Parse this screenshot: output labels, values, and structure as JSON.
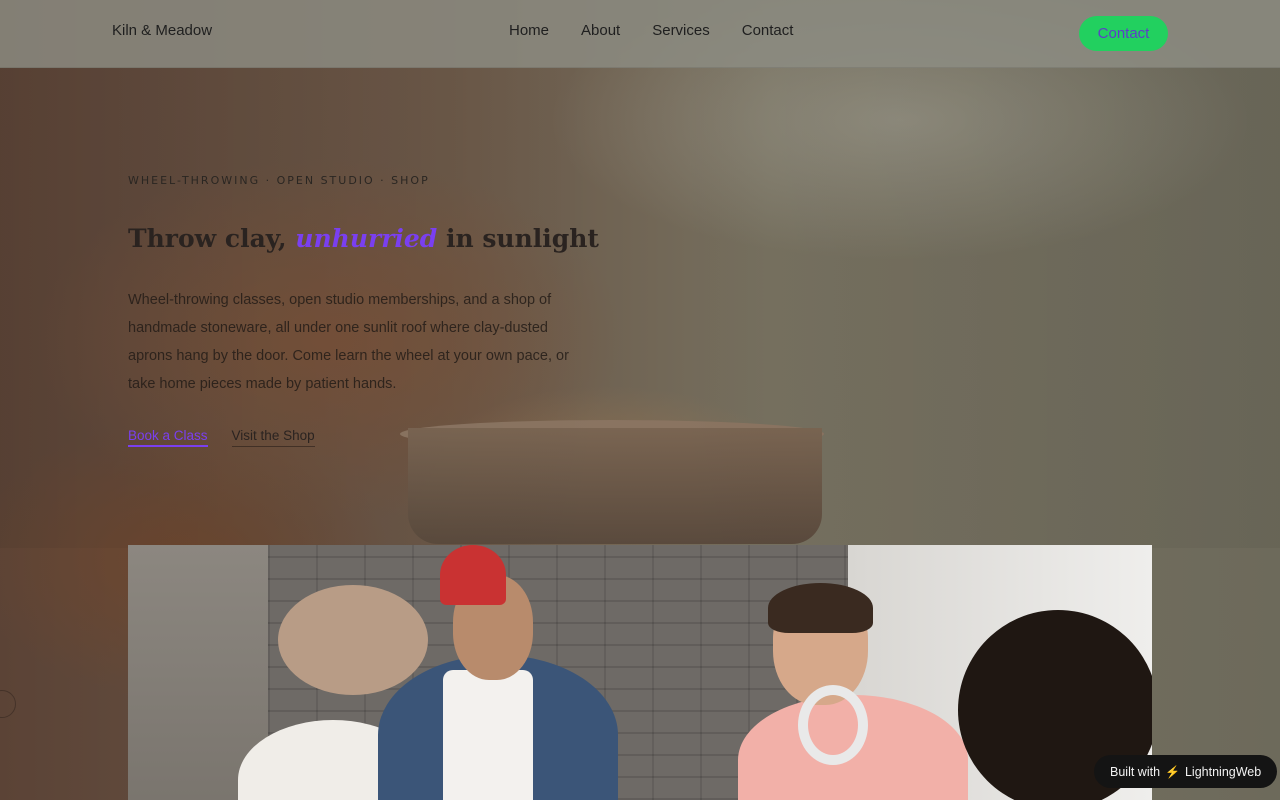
{
  "nav": {
    "brand": "Kiln & Meadow",
    "links": [
      "Home",
      "About",
      "Services",
      "Contact"
    ],
    "cta_label": "Contact"
  },
  "hero": {
    "eyebrow": "WHEEL-THROWING · OPEN STUDIO · SHOP",
    "headline_before": "Throw clay, ",
    "headline_accent": "unhurried",
    "headline_after": " in sunlight",
    "lead": "Wheel-throwing classes, open studio memberships, and a shop of handmade stoneware, all under one sunlit roof where clay-dusted aprons hang by the door. Come learn the wheel at your own pace, or take home pieces made by patient hands.",
    "cta_primary": "Book a Class",
    "cta_secondary": "Visit the Shop"
  },
  "badge": {
    "prefix": "Built with",
    "icon": "lightning-icon",
    "name": "LightningWeb"
  },
  "colors": {
    "accent": "#7a3ff0",
    "cta_bg": "#22d05f",
    "cta_text": "#5b3fc8",
    "badge_bg": "#141414"
  }
}
